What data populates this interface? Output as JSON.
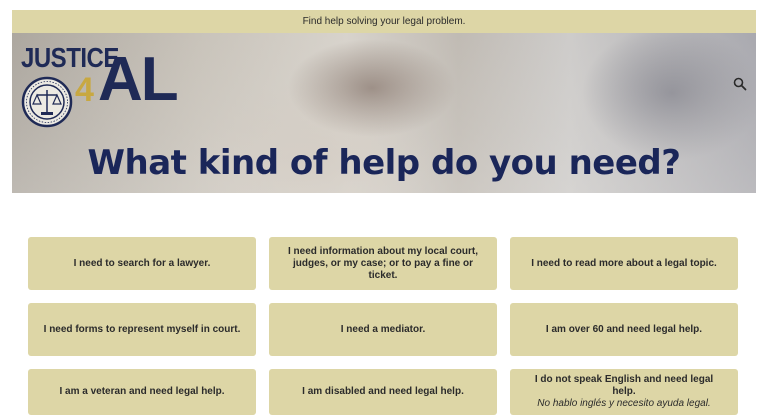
{
  "topbar": {
    "text": "Find help solving your legal problem."
  },
  "hero": {
    "logo_justice": "JUSTICE",
    "logo_four": "4",
    "logo_al": "AL",
    "title": "What kind of help do you need?"
  },
  "icons": {
    "search": "search-icon",
    "seal": "alabama-seal-icon"
  },
  "colors": {
    "card_bg": "#ddd6a6",
    "title": "#1a2659",
    "logo_gold": "#c8a841"
  },
  "cards": [
    {
      "label": "I need to search for a lawyer."
    },
    {
      "label": "I need information about my local court, judges, or my case; or to pay a fine or ticket."
    },
    {
      "label": "I need to read more about a legal topic."
    },
    {
      "label": "I need forms to represent myself in court."
    },
    {
      "label": "I need a mediator."
    },
    {
      "label": "I am over 60 and need legal help."
    },
    {
      "label": "I am a veteran and need legal help."
    },
    {
      "label": "I am disabled and need legal help."
    },
    {
      "label": "I do not speak English and need legal help.",
      "sub": "No hablo inglés y necesito ayuda legal."
    }
  ]
}
